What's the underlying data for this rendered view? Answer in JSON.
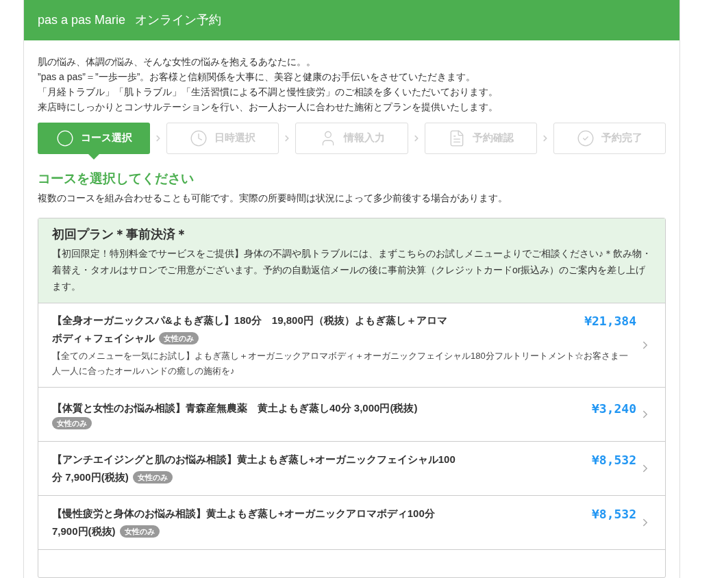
{
  "header": {
    "shop_name": "pas a pas Marie",
    "title": "オンライン予約"
  },
  "intro": [
    "肌の悩み、体調の悩み、そんな女性の悩みを抱えるあなたに。。",
    "”pas a pas”＝”一歩一歩”。お客様と信頼関係を大事に、美容と健康のお手伝いをさせていただきます。",
    "「月経トラブル」「肌トラブル」「生活習慣による不調と慢性疲労」のご相談を多くいただいております。",
    "来店時にしっかりとコンサルテーションを行い、お一人お一人に合わせた施術とプランを提供いたします。"
  ],
  "steps": [
    {
      "label": "コース選択",
      "selected": true
    },
    {
      "label": "日時選択",
      "selected": false
    },
    {
      "label": "情報入力",
      "selected": false
    },
    {
      "label": "予約確認",
      "selected": false
    },
    {
      "label": "予約完了",
      "selected": false
    }
  ],
  "section": {
    "heading": "コースを選択してください",
    "note": "複数のコースを組み合わせることも可能です。実際の所要時間は状況によって多少前後する場合があります。"
  },
  "category": {
    "title": "初回プラン＊事前決済＊",
    "description": "【初回限定！特別料金でサービスをご提供】身体の不調や肌トラブルには、まずこちらのお試しメニューよりでご相談ください♪＊飲み物・着替え・タオルはサロンでご用意がございます。予約の自動返信メールの後に事前決算（クレジットカードor振込み）のご案内を差し上げます。"
  },
  "courses": [
    {
      "title_lines": [
        "【全身オーガニックスパ&よもぎ蒸し】180分　19,800円（税抜）よもぎ蒸し＋アロマ",
        "ボディ＋フェイシャル"
      ],
      "badge": "女性のみ",
      "description": "【全てのメニューを一気にお試し】よもぎ蒸し＋オーガニックアロマボディ＋オーガニックフェイシャル180分フルトリートメント☆お客さま一人一人に合ったオールハンドの癒しの施術を♪",
      "price": "¥21,384"
    },
    {
      "title_lines": [
        "【体質と女性のお悩み相談】青森産無農薬　黄土よもぎ蒸し40分 3,000円(税抜)"
      ],
      "badge": "女性のみ",
      "price": "¥3,240"
    },
    {
      "title_lines": [
        "【アンチエイジングと肌のお悩み相談】黄土よもぎ蒸し+オーガニックフェイシャル100",
        "分 7,900円(税抜)"
      ],
      "badge": "女性のみ",
      "price": "¥8,532"
    },
    {
      "title_lines": [
        "【慢性疲労と身体のお悩み相談】黄土よもぎ蒸し+オーガニックアロマボディ100分",
        "7,900円(税抜)"
      ],
      "badge": "女性のみ",
      "price": "¥8,532"
    }
  ]
}
